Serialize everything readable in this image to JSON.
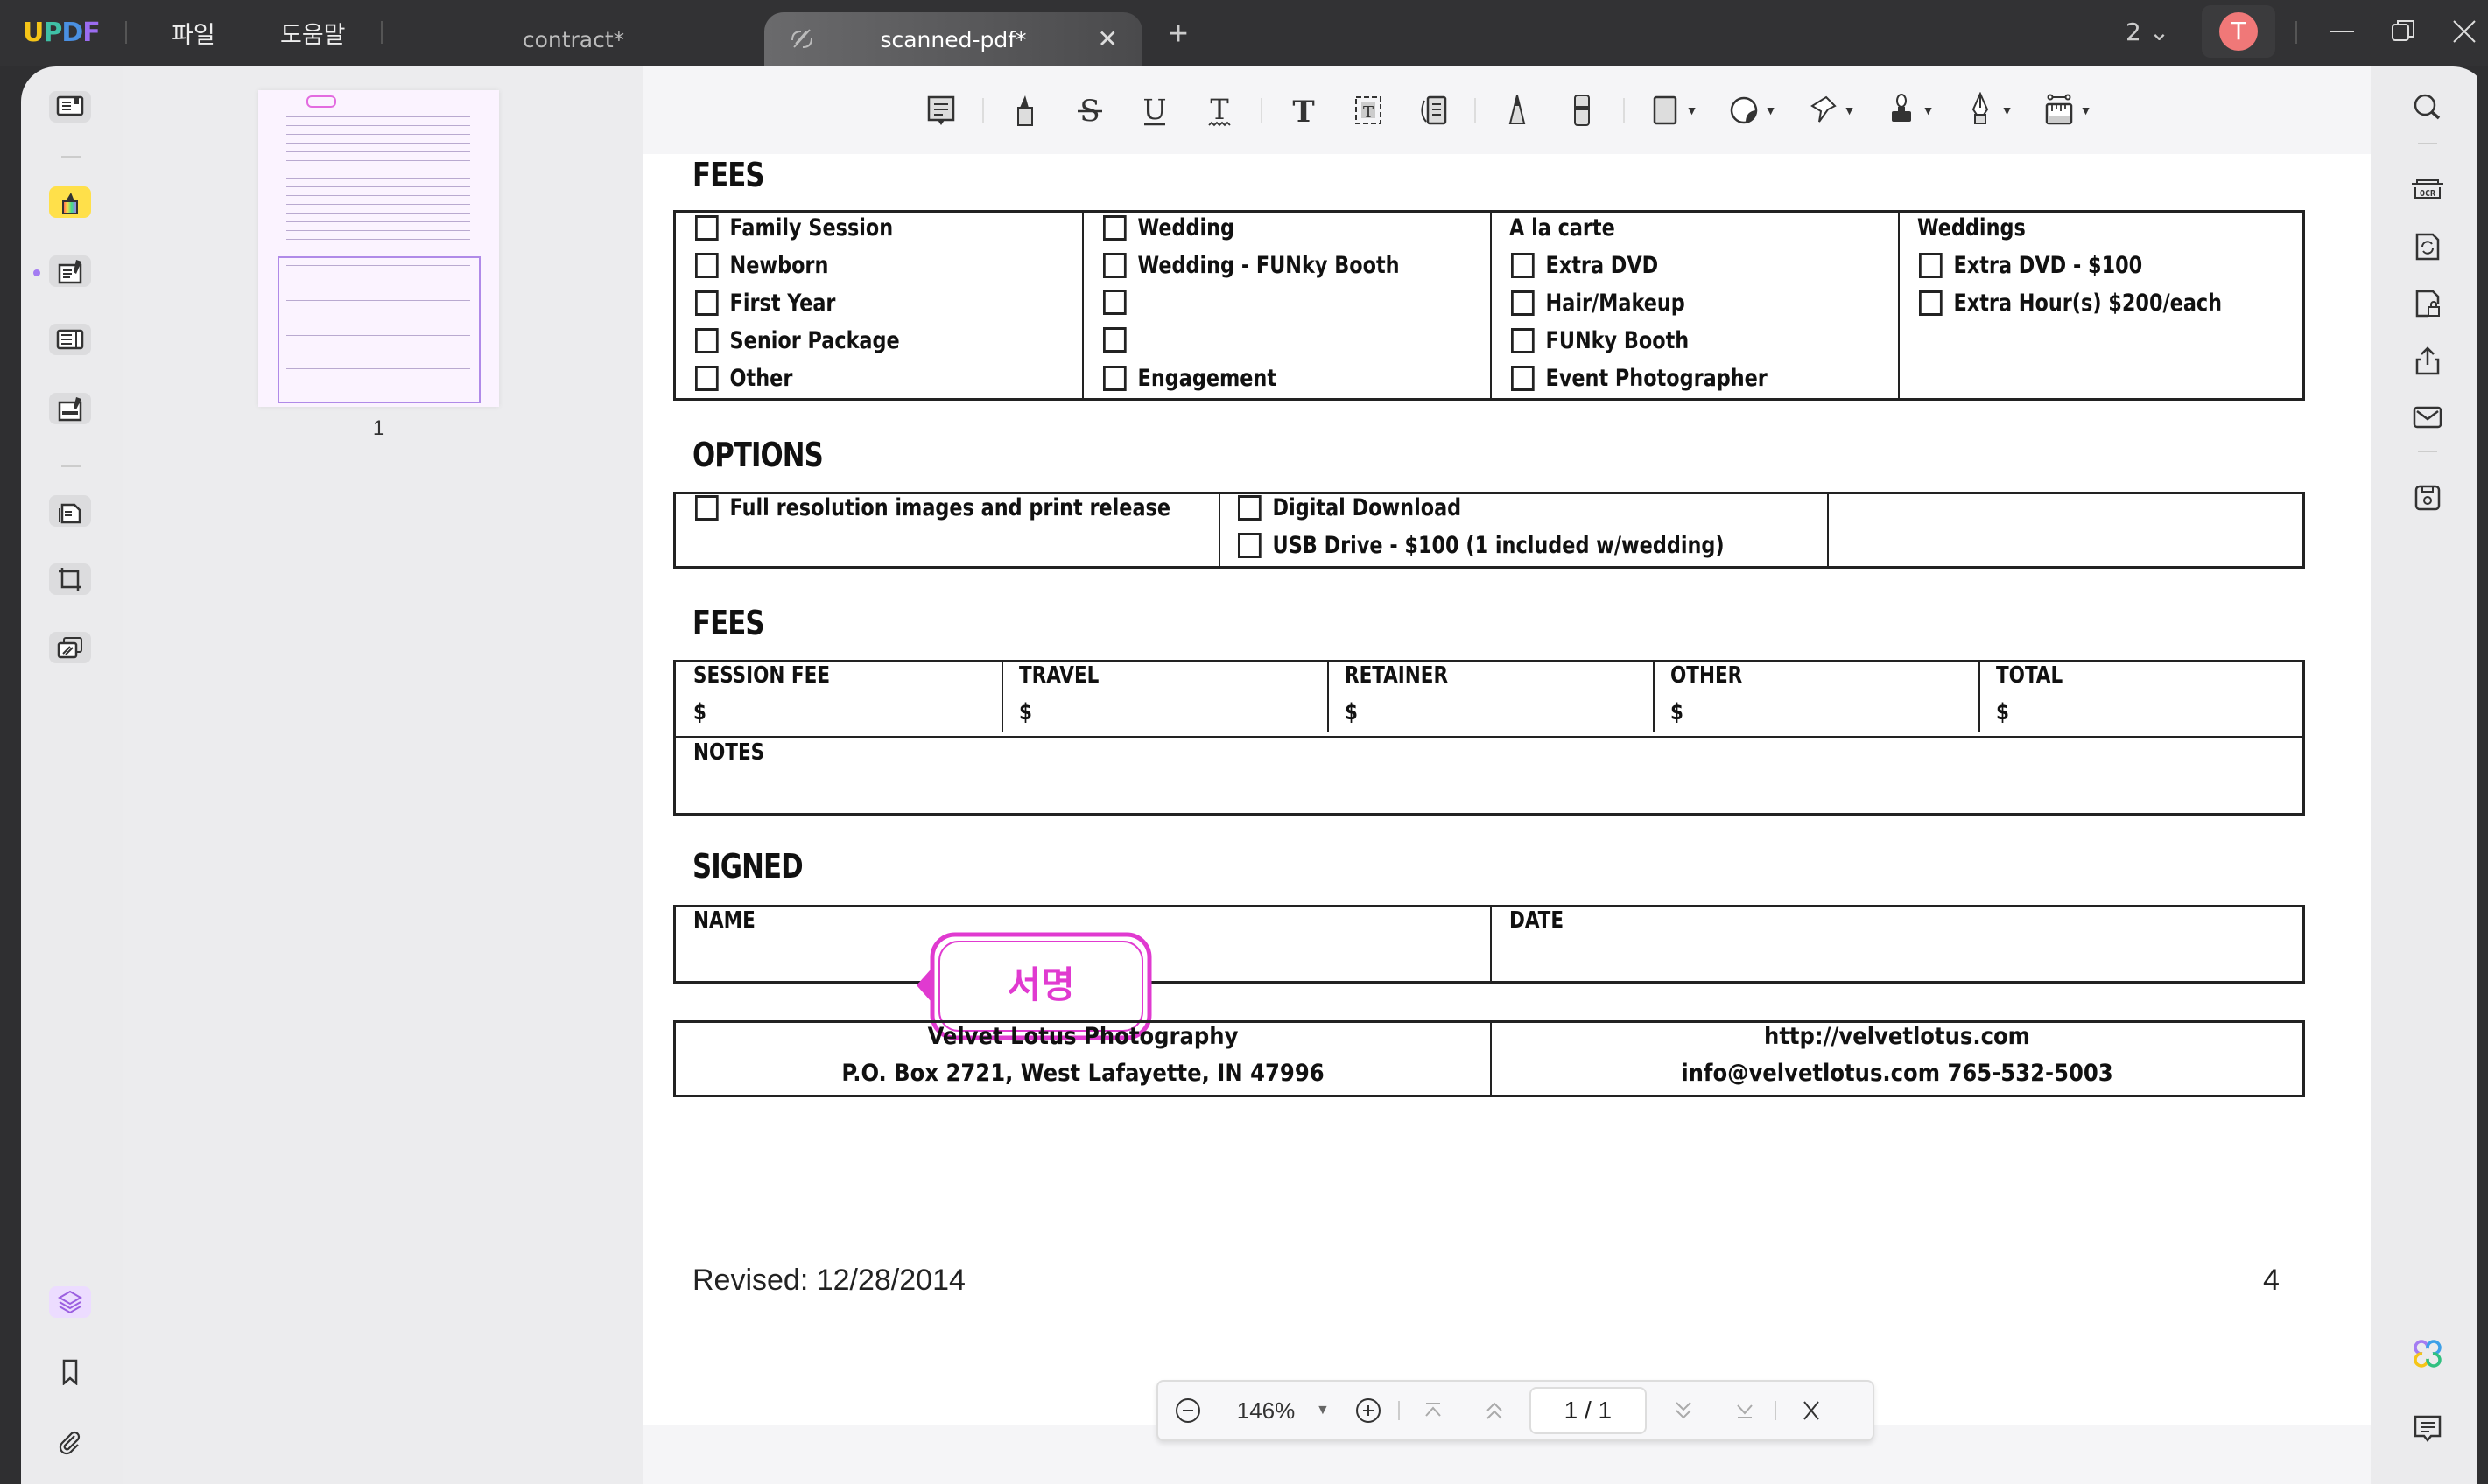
{
  "app": {
    "name_parts": [
      "U",
      "P",
      "D",
      "F"
    ]
  },
  "titlebar": {
    "menus": [
      "파일",
      "도움말"
    ],
    "tabs": [
      {
        "label": "contract*",
        "active": false
      },
      {
        "label": "scanned-pdf*",
        "active": true
      }
    ],
    "page_count_label": "2",
    "avatar_initial": "T"
  },
  "thumbnail": {
    "page_label": "1"
  },
  "document": {
    "fees_heading": "FEES",
    "fees_columns": [
      {
        "header": null,
        "items": [
          "Family Session",
          "Newborn",
          "First Year",
          "Senior Package",
          "Other"
        ]
      },
      {
        "header": null,
        "items": [
          "Wedding",
          "Wedding - FUNky Booth",
          "",
          "",
          "Engagement"
        ]
      },
      {
        "header": "A la carte",
        "items": [
          "Extra DVD",
          "Hair/Makeup",
          "FUNky Booth",
          "Event Photographer"
        ]
      },
      {
        "header": "Weddings",
        "items": [
          "Extra DVD - $100",
          "Extra Hour(s) $200/each"
        ]
      }
    ],
    "options_heading": "OPTIONS",
    "options": {
      "col1": [
        "Full resolution images and print release"
      ],
      "col2": [
        "Digital Download",
        "USB Drive - $100 (1 included w/wedding)"
      ]
    },
    "fees2_heading": "FEES",
    "fee_fields": [
      {
        "label": "SESSION FEE",
        "value": "$"
      },
      {
        "label": "TRAVEL",
        "value": "$"
      },
      {
        "label": "RETAINER",
        "value": "$"
      },
      {
        "label": "OTHER",
        "value": "$"
      },
      {
        "label": "TOTAL",
        "value": "$"
      }
    ],
    "notes_label": "NOTES",
    "signed_heading": "SIGNED",
    "name_label": "NAME",
    "date_label": "DATE",
    "signature_tag": "서명",
    "company": {
      "name": "Velvet Lotus Photography",
      "address": "P.O. Box 2721, West Lafayette, IN 47996",
      "website": "http://velvetlotus.com",
      "contact": "info@velvetlotus.com 765-532-5003"
    },
    "revised": "Revised: 12/28/2014",
    "page_number": "4"
  },
  "navbar": {
    "zoom": "146%",
    "page_indicator": "1 / 1"
  },
  "colors": {
    "accent": "#a47cf2",
    "signature": "#e03ad0",
    "highlight_tool": "#ffe04a",
    "avatar": "#f07878"
  }
}
